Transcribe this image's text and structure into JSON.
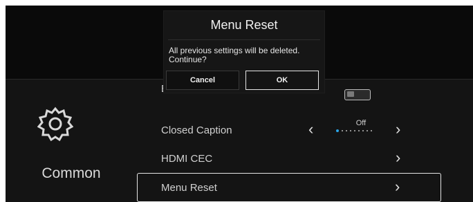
{
  "category": {
    "label": "Common",
    "icon": "gear-icon"
  },
  "menu": {
    "items": [
      {
        "label": "Blue Screen",
        "control": "toggle",
        "state": "off"
      },
      {
        "label": "Closed Caption",
        "control": "selector",
        "value": "Off",
        "prev_icon": "chevron-left-icon",
        "next_icon": "chevron-right-icon"
      },
      {
        "label": "HDMI CEC",
        "control": "submenu",
        "icon": "chevron-right-icon"
      },
      {
        "label": "Menu Reset",
        "control": "submenu",
        "icon": "chevron-right-icon",
        "selected": true
      }
    ]
  },
  "dialog": {
    "title": "Menu Reset",
    "message": "All previous settings will be deleted. Continue?",
    "cancel_label": "Cancel",
    "ok_label": "OK",
    "focused_button": "OK"
  },
  "colors": {
    "background": "#000000",
    "panel": "#141414",
    "text": "#d0d0d0",
    "focus_border": "#e6e6e6",
    "accent": "#2aa5e8"
  }
}
